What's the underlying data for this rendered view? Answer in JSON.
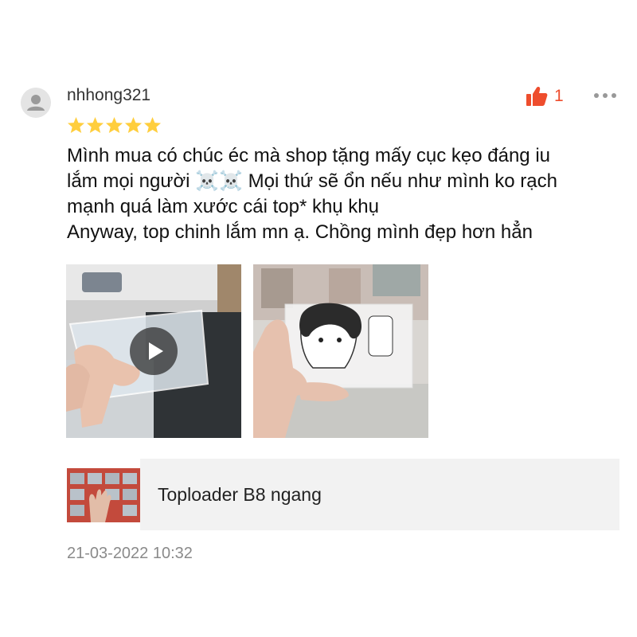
{
  "review": {
    "username": "nhhong321",
    "rating": 5,
    "like_count": "1",
    "text_lines": [
      "Mình mua có chúc éc mà shop tặng mấy cục kẹo đáng iu",
      "lắm mọi người ☠️☠️ Mọi thứ sẽ ổn nếu như mình ko rạch",
      "mạnh quá làm xước cái top* khụ khụ",
      "Anyway, top chinh lắm mn ạ. Chồng mình đẹp hơn hẳn"
    ],
    "media": [
      {
        "type": "video",
        "icon": "play-icon"
      },
      {
        "type": "image"
      }
    ],
    "product_name": "Toploader B8 ngang",
    "timestamp": "21-03-2022 10:32"
  },
  "colors": {
    "accent": "#ee4d2d",
    "star": "#ffce3d"
  }
}
